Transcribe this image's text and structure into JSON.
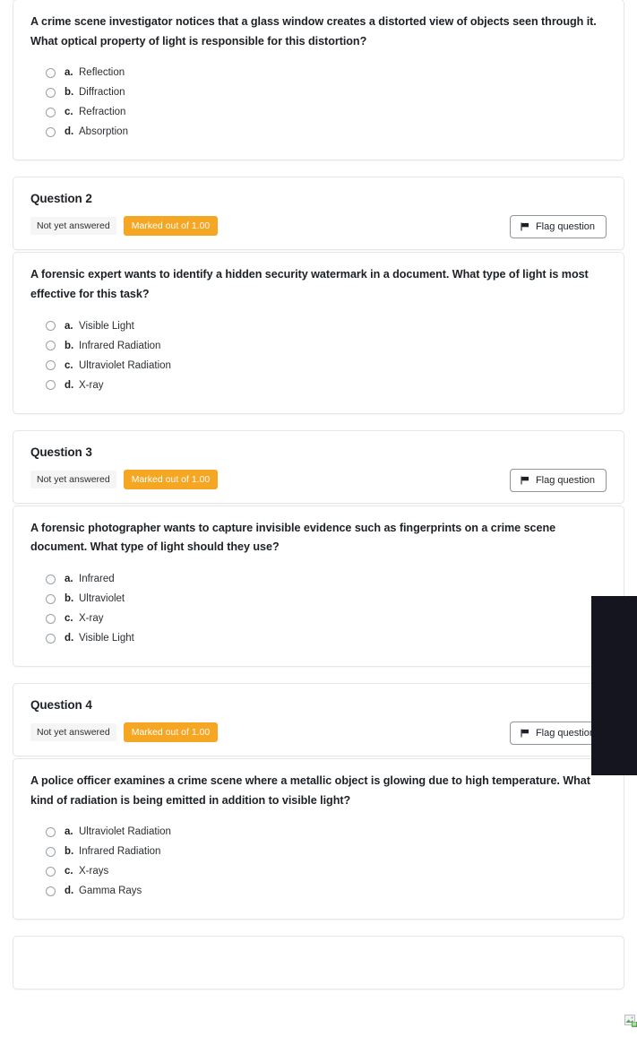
{
  "quiz": {
    "questions": [
      {
        "header": null,
        "text": "A crime scene investigator notices that a glass window creates a distorted view of objects seen through it. What optical property of light is responsible for this distortion?",
        "options": [
          {
            "letter": "a.",
            "label": "Reflection"
          },
          {
            "letter": "b.",
            "label": "Diffraction"
          },
          {
            "letter": "c.",
            "label": "Refraction"
          },
          {
            "letter": "d.",
            "label": "Absorption"
          }
        ]
      },
      {
        "header": {
          "title": "Question 2",
          "state": "Not yet answered",
          "grade": "Marked out of 1.00",
          "flag_label": "Flag question"
        },
        "text": "A forensic expert wants to identify a hidden security watermark in a document. What type of light is most effective for this task?",
        "options": [
          {
            "letter": "a.",
            "label": "Visible Light"
          },
          {
            "letter": "b.",
            "label": "Infrared Radiation"
          },
          {
            "letter": "c.",
            "label": "Ultraviolet Radiation"
          },
          {
            "letter": "d.",
            "label": "X-ray"
          }
        ]
      },
      {
        "header": {
          "title": "Question 3",
          "state": "Not yet answered",
          "grade": "Marked out of 1.00",
          "flag_label": "Flag question"
        },
        "text": "A forensic photographer wants to capture invisible evidence such as fingerprints on a crime scene document. What type of light should they use?",
        "options": [
          {
            "letter": "a.",
            "label": "Infrared"
          },
          {
            "letter": "b.",
            "label": "Ultraviolet"
          },
          {
            "letter": "c.",
            "label": "X-ray"
          },
          {
            "letter": "d.",
            "label": "Visible Light"
          }
        ]
      },
      {
        "header": {
          "title": "Question 4",
          "state": "Not yet answered",
          "grade": "Marked out of 1.00",
          "flag_label": "Flag question"
        },
        "text": "A police officer examines a crime scene where a metallic object is glowing due to high temperature. What kind of radiation is being emitted in addition to visible light?",
        "options": [
          {
            "letter": "a.",
            "label": "Ultraviolet Radiation"
          },
          {
            "letter": "b.",
            "label": "Infrared Radiation"
          },
          {
            "letter": "c.",
            "label": "X-rays"
          },
          {
            "letter": "d.",
            "label": "Gamma Rays"
          }
        ]
      }
    ]
  },
  "icons": {
    "flag": "flag-icon",
    "radio": "radio-button-icon",
    "broken_image": "broken-image-icon"
  },
  "colors": {
    "grade_badge_bg": "#f5a623",
    "state_badge_bg": "#f5f5f5",
    "card_border": "#e6e6e6",
    "text": "#1d2125",
    "overlay_panel": "#15151f"
  }
}
